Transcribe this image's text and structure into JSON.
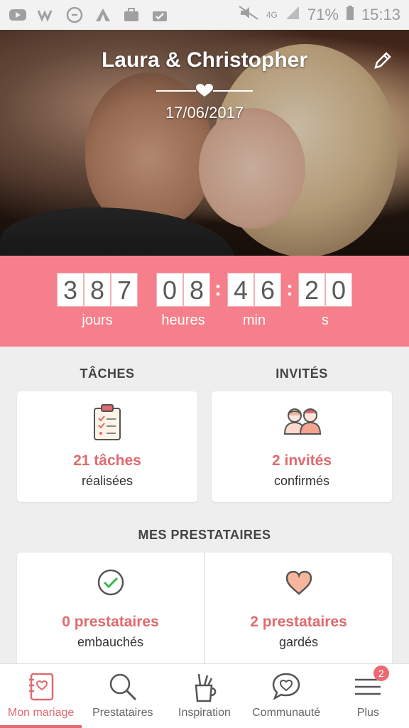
{
  "status_bar": {
    "network": "4G",
    "battery": "71%",
    "time": "15:13",
    "icons": [
      "youtube-icon",
      "wattpad-icon",
      "circle-app-icon",
      "camping-icon",
      "briefcase-icon",
      "check-briefcase-icon",
      "mute-icon",
      "signal-icon",
      "battery-icon"
    ]
  },
  "hero": {
    "names": "Laura & Christopher",
    "date": "17/06/2017",
    "edit_icon": "pencil-icon"
  },
  "countdown": {
    "days": [
      "3",
      "8",
      "7"
    ],
    "hours": [
      "0",
      "8"
    ],
    "minutes": [
      "4",
      "6"
    ],
    "seconds": [
      "2",
      "0"
    ],
    "labels": {
      "days": "jours",
      "hours": "heures",
      "minutes": "min",
      "seconds": "s"
    },
    "background": "#f57f8a"
  },
  "tasks": {
    "title": "TÂCHES",
    "count": "21 tâches",
    "sub": "réalisées",
    "icon": "clipboard-icon"
  },
  "guests": {
    "title": "INVITÉS",
    "count": "2 invités",
    "sub": "confirmés",
    "icon": "couple-icon"
  },
  "vendors": {
    "title": "MES PRESTATAIRES",
    "hired": {
      "count": "0 prestataires",
      "sub": "embauchés",
      "icon": "check-circle-icon"
    },
    "saved": {
      "count": "2 prestataires",
      "sub": "gardés",
      "icon": "heart-icon"
    }
  },
  "nav": {
    "items": [
      {
        "label": "Mon mariage",
        "icon": "notebook-icon",
        "active": true
      },
      {
        "label": "Prestataires",
        "icon": "search-icon"
      },
      {
        "label": "Inspiration",
        "icon": "pencil-cup-icon"
      },
      {
        "label": "Communauté",
        "icon": "chat-heart-icon"
      },
      {
        "label": "Plus",
        "icon": "menu-icon",
        "badge": "2"
      }
    ]
  },
  "colors": {
    "accent": "#e06a6f",
    "countdown_bg": "#f57f8a"
  }
}
